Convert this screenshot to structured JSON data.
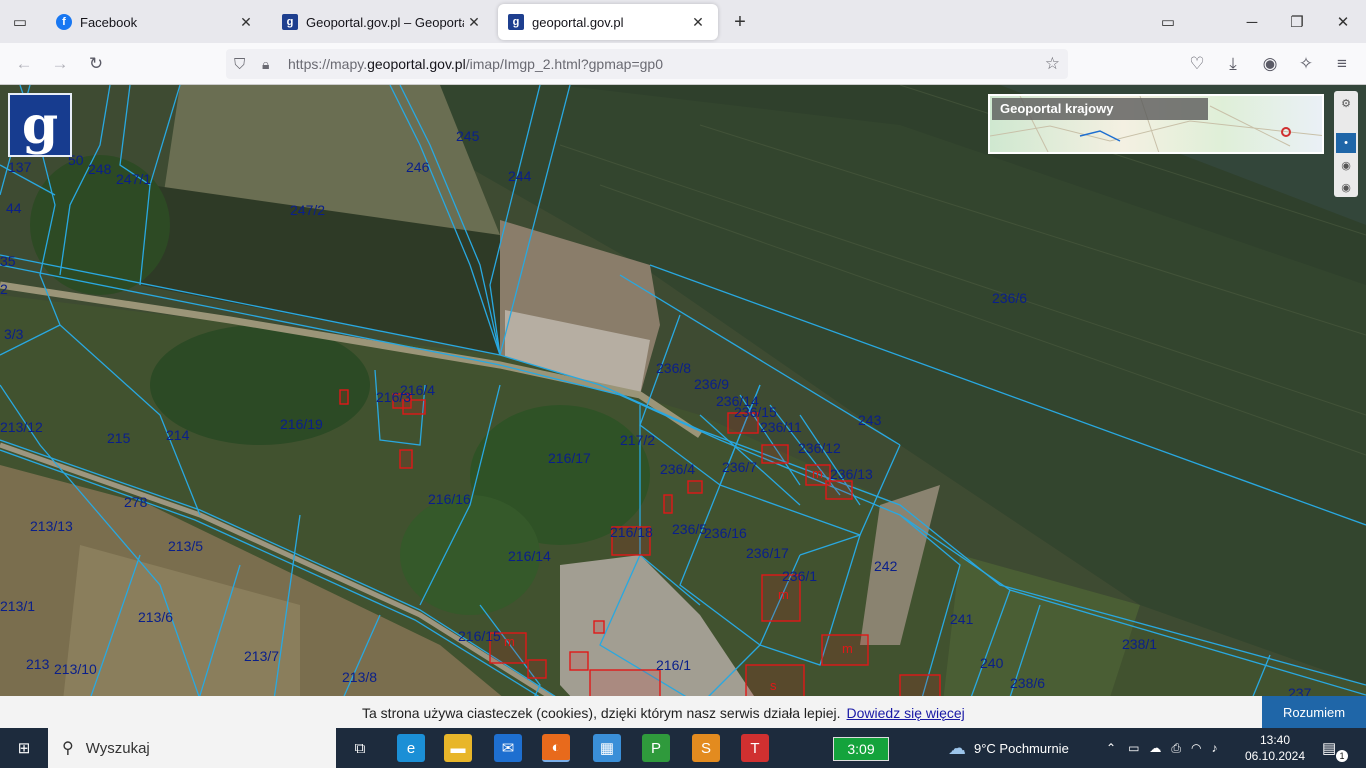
{
  "browser": {
    "tabs": [
      {
        "title": "Facebook",
        "icon": "facebook-icon"
      },
      {
        "title": "Geoportal.gov.pl – Geoportal Infr",
        "icon": "geoportal-icon"
      },
      {
        "title": "geoportal.gov.pl",
        "icon": "geoportal-icon"
      }
    ],
    "url_prefix": "https://mapy.",
    "url_domain": "geoportal.gov.pl",
    "url_path": "/imap/Imgp_2.html?gpmap=gp0"
  },
  "map": {
    "overview_title": "Geoportal krajowy",
    "parcel_labels": [
      "137",
      "50",
      "248",
      "247/1",
      "44",
      "35",
      "2",
      "3/3",
      "247/2",
      "246",
      "245",
      "244",
      "236/6",
      "236/8",
      "236/9",
      "236/14",
      "236/15",
      "236/11",
      "236/12",
      "243",
      "236/13",
      "216/4",
      "216/3",
      "216/19",
      "213/12",
      "215",
      "214",
      "217/2",
      "216/17",
      "236/4",
      "236/7",
      "278",
      "216/16",
      "213/13",
      "213/5",
      "216/18",
      "236/5",
      "236/16",
      "236/17",
      "236/1",
      "242",
      "216/14",
      "213/1",
      "213/6",
      "241",
      "213/7",
      "216/15",
      "213/10",
      "213",
      "216/1",
      "213/8",
      "240",
      "238/6",
      "238/1",
      "237"
    ],
    "building_labels": [
      "m",
      "m",
      "m",
      "m",
      "s"
    ]
  },
  "cookie": {
    "message": "Ta strona używa ciasteczek (cookies), dzięki którym nasz serwis działa lepiej.",
    "link": "Dowiedz się więcej",
    "button": "Rozumiem"
  },
  "taskbar": {
    "search_placeholder": "Wyszukaj",
    "battery_time": "3:09",
    "weather": "9°C  Pochmurnie",
    "time": "13:40",
    "date": "06.10.2024",
    "notification_count": "1"
  },
  "colors": {
    "parcel_border": "#29a8e0",
    "parcel_label": "#0a1f8a",
    "building": "#e01818",
    "cookie_button": "#1f66a8"
  }
}
